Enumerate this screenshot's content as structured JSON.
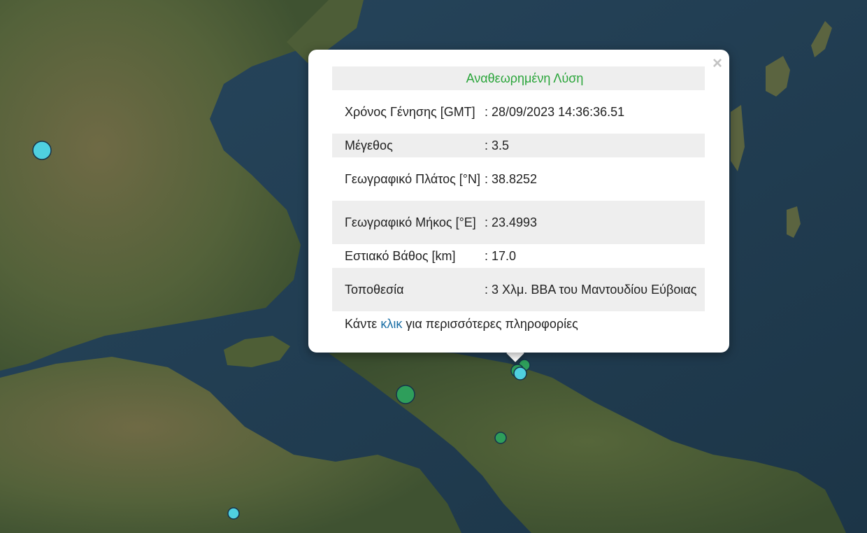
{
  "map": {
    "markers": [
      {
        "color": "#4fd0e0",
        "r": 13
      },
      {
        "color": "#2e9e5b",
        "r": 13
      },
      {
        "color": "#2e9e5b",
        "r": 8
      },
      {
        "color": "#2e9e5b",
        "r": 9
      },
      {
        "color": "#4fd0e0",
        "r": 9
      },
      {
        "color": "#2e9e5b",
        "r": 8
      },
      {
        "color": "#4fd0e0",
        "r": 8
      }
    ]
  },
  "popup": {
    "title": "Αναθεωρημένη Λύση",
    "close_label": "×",
    "rows": [
      {
        "label": "Χρόνος Γένησης [GMT]",
        "value": ": 28/09/2023 14:36:36.51"
      },
      {
        "label": "Μέγεθος",
        "value": ": 3.5"
      },
      {
        "label": "Γεωγραφικό Πλάτος [°N]",
        "value": ": 38.8252"
      },
      {
        "label": "Γεωγραφικό Μήκος [°E]",
        "value": ": 23.4993"
      },
      {
        "label": "Εστιακό Βάθος [km]",
        "value": ": 17.0"
      },
      {
        "label": "Τοποθεσία",
        "value": ": 3 Χλμ. ΒΒΑ του Μαντουδίου Εύβοιας"
      }
    ],
    "more_prefix": "Κάντε",
    "more_link": "κλικ",
    "more_suffix": "για περισσότερες πληροφορίες"
  },
  "colors": {
    "sea": "#1f3a4f",
    "land": "#5d6a3e",
    "title_green": "#2aa53a",
    "link_blue": "#1b6fa5"
  }
}
